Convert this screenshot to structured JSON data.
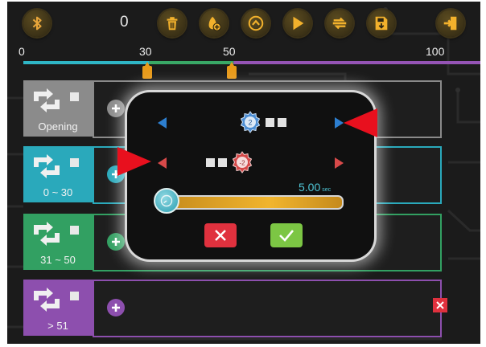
{
  "toolbar": {
    "counter": "0",
    "buttons": [
      "bluetooth-icon",
      "trash-icon",
      "add-sequence-icon",
      "home-icon",
      "play-icon",
      "loop-icon",
      "save-icon",
      "exit-icon"
    ]
  },
  "timeline": {
    "ticks": [
      "0",
      "30",
      "50",
      "100"
    ],
    "markers": [
      30,
      50
    ],
    "segments": [
      {
        "from": 0,
        "to": 30,
        "color": "#2fb6c6"
      },
      {
        "from": 30,
        "to": 50,
        "color": "#39a866"
      },
      {
        "from": 50,
        "to": 100,
        "color": "#9554b5"
      }
    ]
  },
  "rows": [
    {
      "label": "Opening",
      "color": "#8b8b8b",
      "lane_color": "#8a8a8a"
    },
    {
      "label": "0 ~ 30",
      "color": "#2aa9bb",
      "lane_color": "#2aa9bb"
    },
    {
      "label": "31 ~ 50",
      "color": "#32a062",
      "lane_color": "#32a062"
    },
    {
      "label": "> 51",
      "color": "#8d4fae",
      "lane_color": "#8d4fae"
    }
  ],
  "dialog": {
    "top_gear_value": "2",
    "bottom_gear_value": "-2",
    "duration_value": "5.00",
    "duration_unit": "sec",
    "colors": {
      "blue": "#2d7fd0",
      "red": "#d84a4a",
      "cancel": "#e0313e",
      "confirm": "#7cc644"
    }
  }
}
